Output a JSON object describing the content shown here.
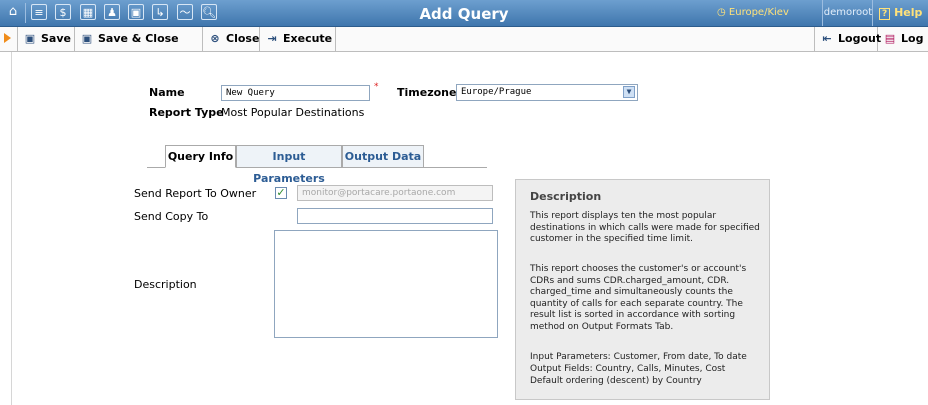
{
  "topbar": {
    "title": "Add Query",
    "timezone_link": "Europe/Kiev",
    "user": "demoroot",
    "help": "Help"
  },
  "toolbar": {
    "save": "Save",
    "save_close": "Save & Close",
    "close": "Close",
    "execute": "Execute",
    "logout": "Logout",
    "log": "Log"
  },
  "form": {
    "name_label": "Name",
    "name_value": "New Query",
    "timezone_label": "Timezone",
    "timezone_value": "Europe/Prague",
    "report_type_label": "Report Type",
    "report_type_value": "Most Popular Destinations"
  },
  "tabs": [
    {
      "label": "Query Info",
      "active": true
    },
    {
      "label": "Input Parameters",
      "active": false
    },
    {
      "label": "Output Data",
      "active": false
    }
  ],
  "query_info": {
    "send_report_label": "Send Report To Owner",
    "send_report_checked": true,
    "owner_email": "monitor@portacare.portaone.com",
    "send_copy_label": "Send Copy To",
    "send_copy_value": "",
    "description_label": "Description",
    "description_value": ""
  },
  "description_panel": {
    "title": "Description",
    "p1": "This report displays ten the most popular destinations in which calls were made for specified customer in the specified time limit.",
    "p2": "This report chooses the customer's or account's CDRs and sums CDR.charged_amount, CDR. charged_time and simultaneously counts the quantity of calls for each separate country. The result list is sorted in accordance with sorting method on Output Formats Tab.",
    "p3_l1": "Input Parameters: Customer, From date, To date",
    "p3_l2": "Output Fields: Country, Calls, Minutes, Cost",
    "p3_l3": "Default ordering (descent) by Country"
  },
  "icons": [
    "home-icon",
    "list-icon",
    "money-icon",
    "grid-icon",
    "person-icon",
    "network-icon",
    "export-icon",
    "chart-icon",
    "search-icon",
    "clock-icon"
  ],
  "colors": {
    "topbar": "#4a82bb",
    "link": "#ffe27a",
    "accent": "#f08c1a"
  }
}
